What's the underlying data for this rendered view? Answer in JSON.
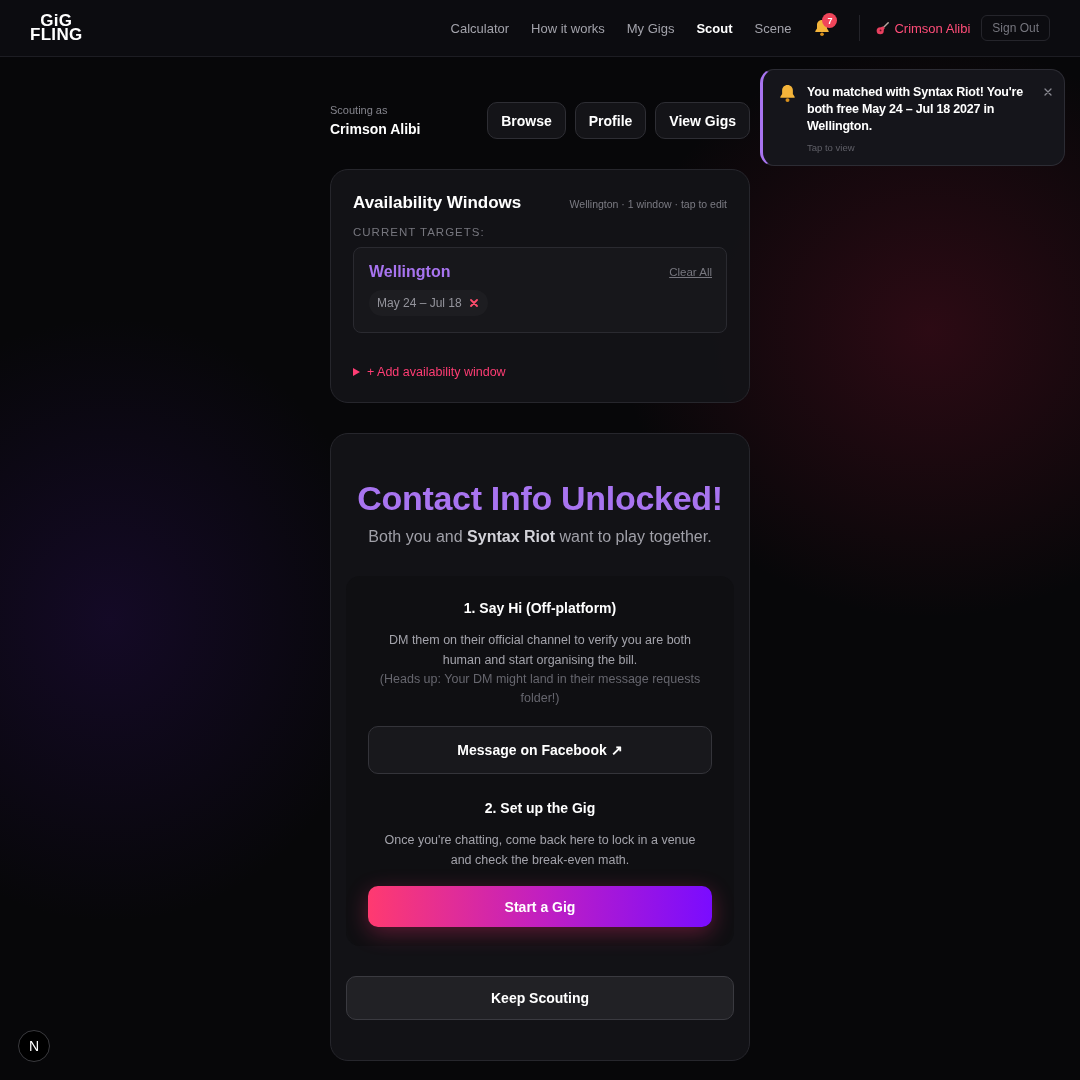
{
  "header": {
    "logo": {
      "lines": [
        "GiG",
        "FLING"
      ]
    },
    "nav": [
      {
        "label": "Calculator",
        "selected": false
      },
      {
        "label": "How it works",
        "selected": false
      },
      {
        "label": "My Gigs",
        "selected": false
      },
      {
        "label": "Scout",
        "selected": true
      },
      {
        "label": "Scene",
        "selected": false
      }
    ],
    "notifications": {
      "count": "7"
    },
    "user": {
      "name": "Crimson Alibi"
    },
    "sign_out": "Sign Out"
  },
  "toast": {
    "message": "You matched with Syntax Riot! You're both free May 24 – Jul 18 2027 in Wellington.",
    "hint": "Tap to view"
  },
  "scouting": {
    "label": "Scouting as",
    "name": "Crimson Alibi",
    "buttons": [
      "Browse",
      "Profile",
      "View Gigs"
    ]
  },
  "availability": {
    "title": "Availability Windows",
    "meta": "Wellington · 1 window · tap to edit",
    "targets_label": "CURRENT TARGETS:",
    "targets": [
      {
        "city": "Wellington",
        "clear": "Clear All",
        "windows": [
          {
            "label": "May 24 – Jul 18"
          }
        ]
      }
    ],
    "add": {
      "label": "+ Add availability window",
      "expanded": false
    }
  },
  "unlocked": {
    "title": "Contact Info Unlocked!",
    "subtitle": "Both you and **Syntax Riot** want to play together.",
    "steps": [
      {
        "title": "1. Say Hi (Off-platform)",
        "text": "DM them on their official channel to verify you are both human and start organising the bill.",
        "note": "(Heads up: Your DM might land in their message requests folder!)",
        "button": {
          "label": "Message on Facebook ↗",
          "kind": "secondary"
        }
      },
      {
        "title": "2. Set up the Gig",
        "text": "Once you're chatting, come back here to lock in a venue and check the break-even math.",
        "button": {
          "label": "Start a Gig",
          "kind": "primary"
        }
      }
    ],
    "keep": "Keep Scouting"
  },
  "dev_badge": {
    "label": "N"
  }
}
